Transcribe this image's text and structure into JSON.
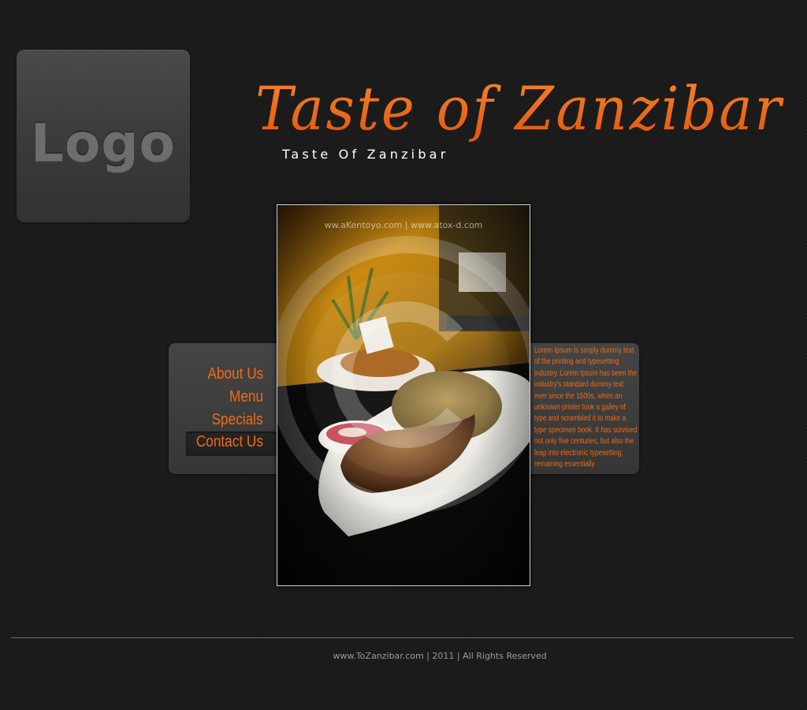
{
  "logo": {
    "text": "Logo"
  },
  "header": {
    "title": "Taste of Zanzibar",
    "tagline": "Taste Of Zanzibar"
  },
  "nav": {
    "items": [
      {
        "label": "About Us"
      },
      {
        "label": "Menu"
      },
      {
        "label": "Specials"
      },
      {
        "label": "Contact Us",
        "active": true
      }
    ]
  },
  "content": {
    "text": "Lorem Ipsum is simply dummy text of the printing and typesetting industry. Lorem Ipsum has been the industry's standard dummy text ever since the 1500s, when an unknown printer took a galley of type and scrambled it to make a type specimen book. It has survived not only five centuries, but also the leap into electronic typesetting, remaining essentially"
  },
  "photo": {
    "watermark": "ww.aKentoyo.com | www.atox-d.com"
  },
  "footer": {
    "text": "www.ToZanzibar.com | 2011 | All Rights Reserved"
  },
  "colors": {
    "accent": "#f26a14",
    "background": "#1c1c1c",
    "panel": "#3d3d3d"
  }
}
